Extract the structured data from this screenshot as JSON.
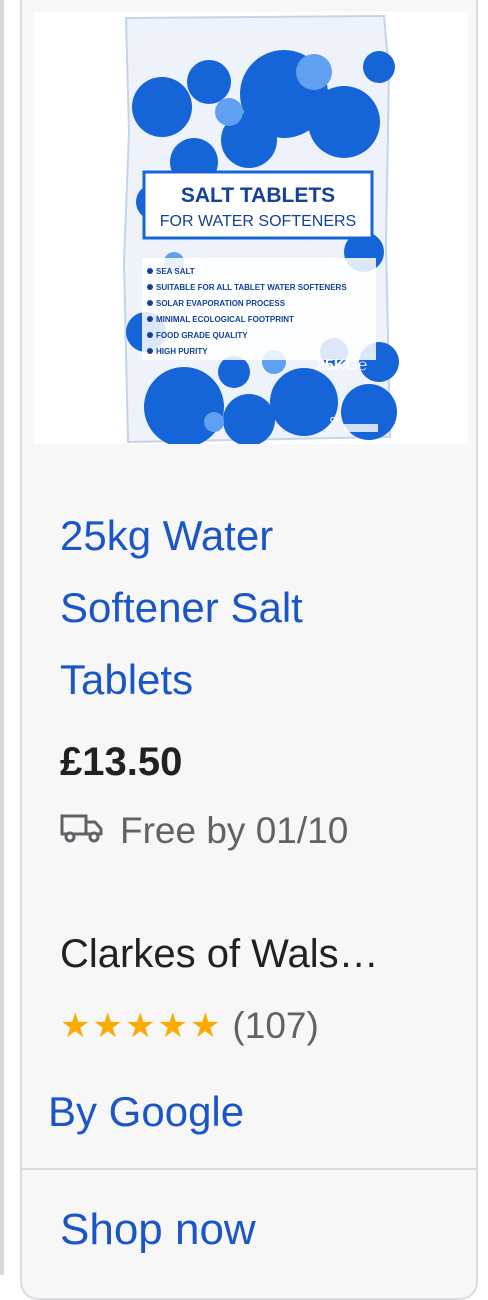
{
  "product": {
    "title": "25kg Water Softener Salt Tablets",
    "price": "£13.50",
    "shipping": "Free by 01/10",
    "seller": "Clarkes of Wals…",
    "rating_value": 5,
    "rating_count": "(107)",
    "by_label": "By Google",
    "cta_label": "Shop now"
  },
  "packaging": {
    "title_line1": "SALT TABLETS",
    "title_line2": "FOR WATER SOFTENERS",
    "bullets": [
      "SEA SALT",
      "SUITABLE FOR ALL TABLET WATER SOFTENERS",
      "SOLAR EVAPORATION PROCESS",
      "MINIMAL ECOLOGICAL FOOTPRINT",
      "FOOD GRADE QUALITY",
      "HIGH PURITY"
    ],
    "weight": "25KG℮",
    "maker_mark": "CW"
  },
  "icons": {
    "shipping": "truck-icon",
    "rating": "star-icon"
  },
  "colors": {
    "link": "#1a56c8",
    "star": "#f9ab00",
    "bag_blue": "#1565d8"
  }
}
